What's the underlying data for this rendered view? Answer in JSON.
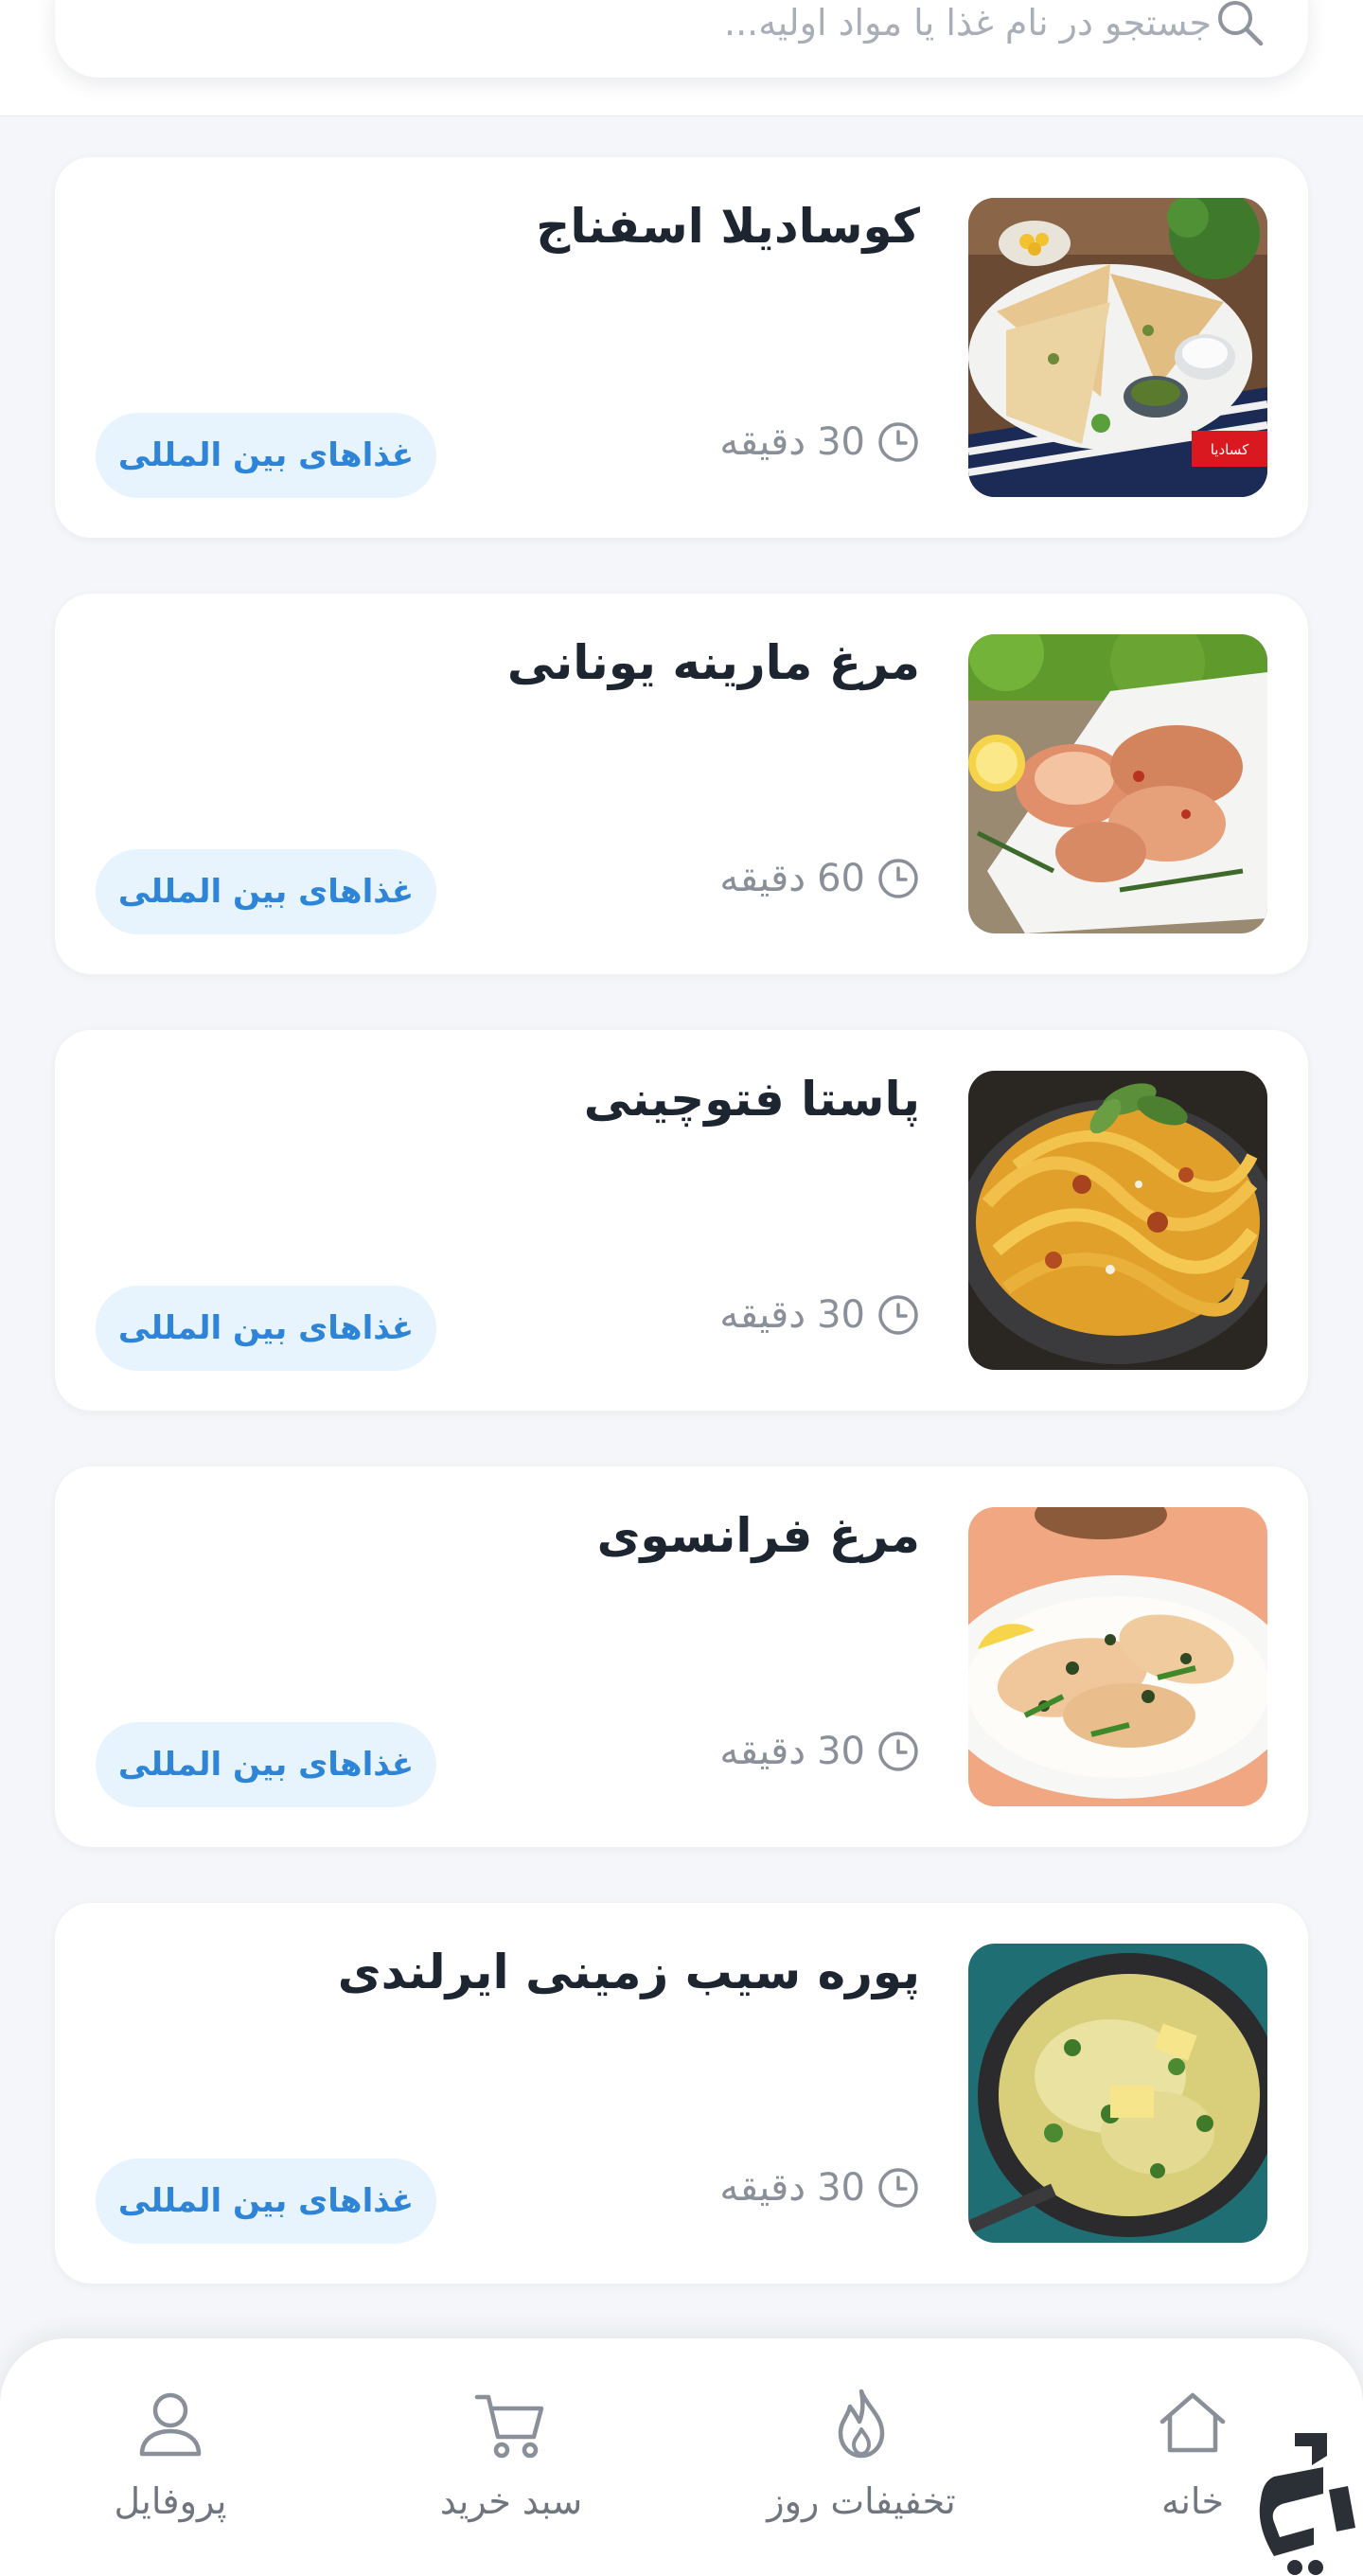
{
  "search": {
    "placeholder": "جستجو در نام غذا یا مواد اولیه...",
    "icon": "search-icon"
  },
  "colors": {
    "accent": "#2e84d6",
    "badge_bg": "#e7f3fd",
    "title": "#1d2530",
    "muted": "#8a9099",
    "background": "#f4f6f9"
  },
  "recipes": [
    {
      "title": "کوسادیلا اسفناج",
      "time_value": "30",
      "time_unit": "دقیقه",
      "category": "غذاهای بین المللی",
      "image_caption": "کسادیا"
    },
    {
      "title": "مرغ مارینه یونانی",
      "time_value": "60",
      "time_unit": "دقیقه",
      "category": "غذاهای بین المللی"
    },
    {
      "title": "پاستا فتوچینی",
      "time_value": "30",
      "time_unit": "دقیقه",
      "category": "غذاهای بین المللی"
    },
    {
      "title": "مرغ فرانسوی",
      "time_value": "30",
      "time_unit": "دقیقه",
      "category": "غذاهای بین المللی"
    },
    {
      "title": "پوره سیب زمینی ایرلندی",
      "time_value": "30",
      "time_unit": "دقیقه",
      "category": "غذاهای بین المللی"
    }
  ],
  "bottom_nav": {
    "items": [
      {
        "label": "خانه",
        "icon": "home-icon"
      },
      {
        "label": "تخفیفات روز",
        "icon": "flame-icon"
      },
      {
        "label": "سبد خرید",
        "icon": "cart-icon"
      },
      {
        "label": "پروفایل",
        "icon": "profile-icon"
      }
    ]
  }
}
